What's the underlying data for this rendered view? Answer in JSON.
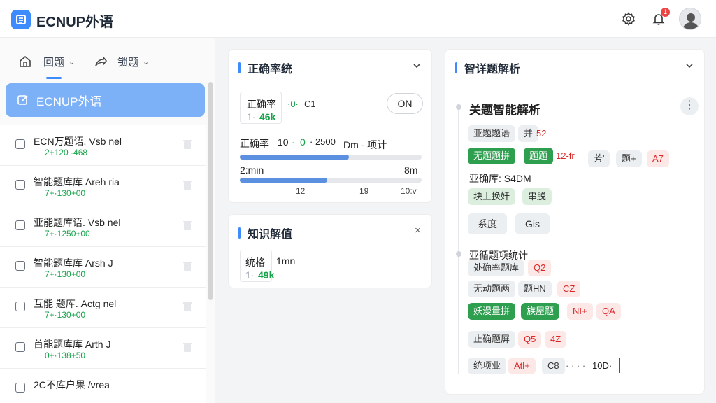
{
  "header": {
    "app_title": "ECNUP外语",
    "notification_count": "1"
  },
  "sidebar": {
    "tabs": [
      {
        "label": "回题"
      },
      {
        "label": "锁题"
      }
    ],
    "active_item": {
      "label": "ECNUP外语"
    },
    "items": [
      {
        "title": "ECN万题语. Vsb nel",
        "sub": "2+120 ·468"
      },
      {
        "title": "智能题库库 Areh ria",
        "sub": "7+·130+00"
      },
      {
        "title": "亚能题库语. Vsb nel",
        "sub": "7+·1250+00"
      },
      {
        "title": "智能题库库 Arsh J",
        "sub": "7+·130+00"
      },
      {
        "title": "互能 题库. Actg nel",
        "sub": "7+·130+00"
      },
      {
        "title": "首能题库库 Arth J",
        "sub": "0+·138+50"
      },
      {
        "title": "2C不库户果 /vrea",
        "sub": ""
      }
    ]
  },
  "accuracy_card": {
    "title": "正确率统",
    "box_label": "正确率",
    "box_delta": "·0·",
    "box_code": "C1",
    "box_value_prefix": "1·",
    "box_value": "46k",
    "toggle_label": "ON",
    "row1_label": "正确率",
    "row1_num": "10",
    "row1_arrow": "·",
    "row1_zero": "0",
    "row1_num2": "· 2500",
    "row1_suffix": "Dm - 项计",
    "progress1": 0.6,
    "time_left": "2:min",
    "time_right": "8m",
    "progress2": 0.48,
    "tick_a": "12",
    "tick_b": "19",
    "tick_c": "10:v"
  },
  "knowledge_card": {
    "title": "知识解值",
    "box_label": "统格",
    "box_value_prefix": "1·",
    "box_value": "49k",
    "time": "1mn"
  },
  "analysis_card": {
    "title": "智详题解析",
    "section_title": "关题智能解析",
    "row1": [
      "亚题题语",
      "并",
      "52"
    ],
    "row2": [
      "无题题拼",
      "题题",
      "12-fr",
      "芳'",
      "题+",
      "A7"
    ],
    "row3_label": "亚确库: S4DM",
    "row4": [
      "块上换奸",
      "串脱"
    ],
    "buttons": [
      "系度",
      "Gis"
    ],
    "section2_title": "亚循题项统计",
    "row5": [
      "处确率题库",
      "Q2"
    ],
    "row6": [
      "无动题两",
      "题HN",
      "CZ"
    ],
    "row7": [
      "妖漫量拼",
      "族屋题",
      "NI+",
      "QA"
    ],
    "row8": [
      "止确题屏",
      "Q5",
      "4Z"
    ],
    "row9": [
      "统项业",
      "Atl+",
      "C8",
      "· · · ·",
      "10D·"
    ]
  },
  "colors": {
    "accent": "#3d8bfd",
    "green": "#16a34a",
    "chip_green": "#2e9e4f",
    "red": "#dc2626"
  }
}
